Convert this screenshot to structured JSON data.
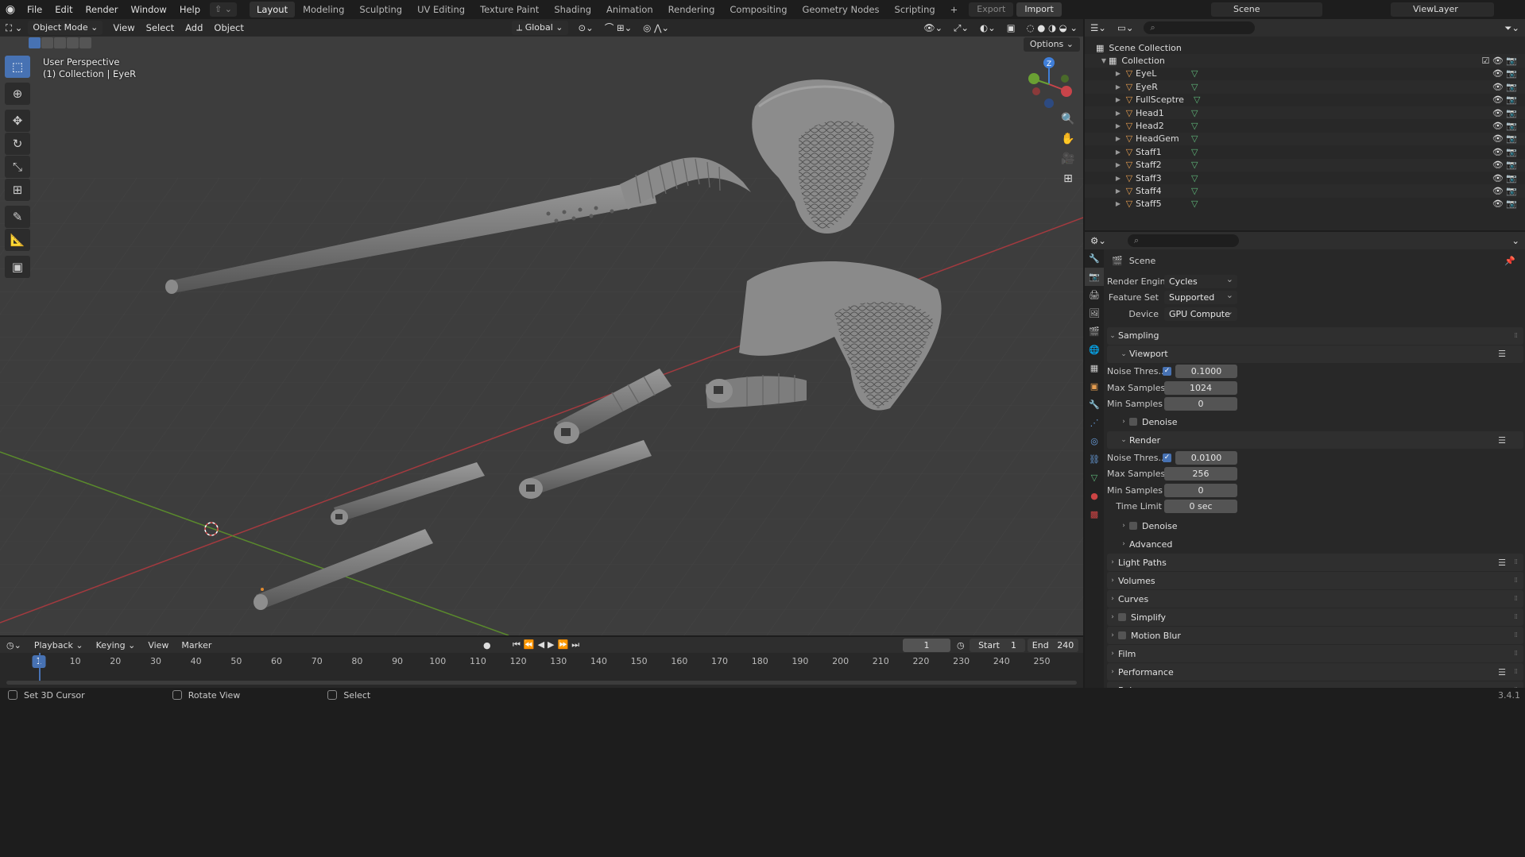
{
  "topbar": {
    "menus": [
      "File",
      "Edit",
      "Render",
      "Window",
      "Help"
    ],
    "workspaces": [
      "Layout",
      "Modeling",
      "Sculpting",
      "UV Editing",
      "Texture Paint",
      "Shading",
      "Animation",
      "Rendering",
      "Compositing",
      "Geometry Nodes",
      "Scripting"
    ],
    "active_workspace": "Layout",
    "export_label": "Export",
    "import_label": "Import",
    "scene_name": "Scene",
    "view_layer": "ViewLayer"
  },
  "viewport_header": {
    "mode": "Object Mode",
    "menus": [
      "View",
      "Select",
      "Add",
      "Object"
    ],
    "orientation": "Global",
    "options_label": "Options"
  },
  "viewport": {
    "perspective_label": "User Perspective",
    "collection_label": "(1) Collection | EyeR",
    "gizmo_axes": {
      "x": "X",
      "y": "Y",
      "z": "Z"
    }
  },
  "outliner": {
    "root": "Scene Collection",
    "collection": "Collection",
    "objects": [
      "EyeL",
      "EyeR",
      "FullSceptre",
      "Head1",
      "Head2",
      "HeadGem",
      "Staff1",
      "Staff2",
      "Staff3",
      "Staff4",
      "Staff5"
    ]
  },
  "properties": {
    "scene_title": "Scene",
    "render_engine": {
      "label": "Render Engine",
      "value": "Cycles"
    },
    "feature_set": {
      "label": "Feature Set",
      "value": "Supported"
    },
    "device": {
      "label": "Device",
      "value": "GPU Compute"
    },
    "sampling_label": "Sampling",
    "viewport_label": "Viewport",
    "viewport_noise": {
      "label": "Noise Thres...",
      "value": "0.1000"
    },
    "viewport_max": {
      "label": "Max Samples",
      "value": "1024"
    },
    "viewport_min": {
      "label": "Min Samples",
      "value": "0"
    },
    "denoise_label": "Denoise",
    "render_label": "Render",
    "render_noise": {
      "label": "Noise Thres...",
      "value": "0.0100"
    },
    "render_max": {
      "label": "Max Samples",
      "value": "256"
    },
    "render_min": {
      "label": "Min Samples",
      "value": "0"
    },
    "time_limit": {
      "label": "Time Limit",
      "value": "0 sec"
    },
    "advanced_label": "Advanced",
    "sections": [
      "Light Paths",
      "Volumes",
      "Curves",
      "Simplify",
      "Motion Blur",
      "Film",
      "Performance",
      "Bake"
    ]
  },
  "timeline": {
    "menus": [
      "Playback",
      "Keying",
      "View",
      "Marker"
    ],
    "current_frame": "1",
    "start_label": "Start",
    "start_value": "1",
    "end_label": "End",
    "end_value": "240",
    "ticks": [
      "10",
      "20",
      "30",
      "40",
      "50",
      "60",
      "70",
      "80",
      "90",
      "100",
      "110",
      "120",
      "130",
      "140",
      "150",
      "160",
      "170",
      "180",
      "190",
      "200",
      "210",
      "220",
      "230",
      "240",
      "250"
    ]
  },
  "statusbar": {
    "hint1": "Set 3D Cursor",
    "hint2": "Rotate View",
    "hint3": "Select",
    "version": "3.4.1"
  },
  "colors": {
    "accent": "#4772b3",
    "x_axis": "#c8444a",
    "y_axis": "#6aa033",
    "z_axis": "#3f7ed8",
    "object_orange": "#e59d50",
    "mesh_green": "#5fb87a"
  }
}
